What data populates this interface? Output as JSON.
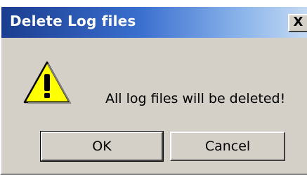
{
  "window": {
    "title": "Delete Log files",
    "close_symbol": "X"
  },
  "dialog": {
    "icon": "warning-icon",
    "message": "All log files will be deleted!",
    "ok_label": "OK",
    "cancel_label": "Cancel"
  },
  "colors": {
    "titlebar_start": "#1a3d8f",
    "titlebar_end": "#c6daf4",
    "face": "#d4d0c8",
    "warning_fill": "#ffff00"
  }
}
